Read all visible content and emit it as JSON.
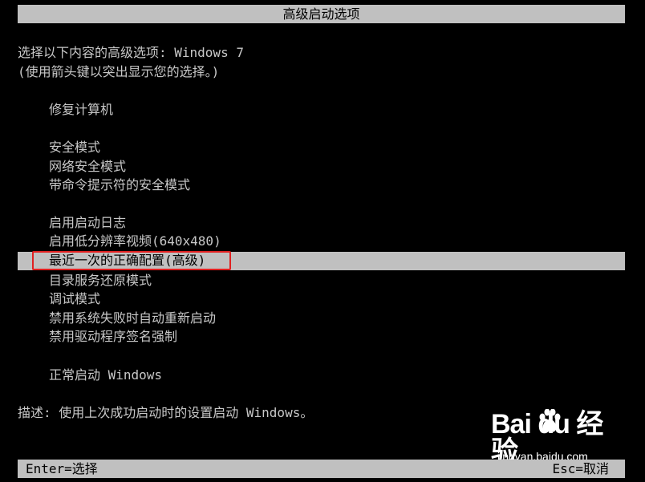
{
  "header": {
    "title": "高级启动选项"
  },
  "prompt": {
    "line1": "选择以下内容的高级选项: Windows 7",
    "line2": "(使用箭头键以突出显示您的选择。)"
  },
  "menu": {
    "repair": "修复计算机",
    "safe_mode": "安全模式",
    "safe_mode_network": "网络安全模式",
    "safe_mode_cmd": "带命令提示符的安全模式",
    "boot_logging": "启用启动日志",
    "low_res_video": "启用低分辨率视频(640x480)",
    "last_known_good": "最近一次的正确配置(高级)",
    "ds_restore": "目录服务还原模式",
    "debugging": "调试模式",
    "disable_auto_restart": "禁用系统失败时自动重新启动",
    "disable_driver_sig": "禁用驱动程序签名强制",
    "start_normally": "正常启动 Windows"
  },
  "description": "描述: 使用上次成功启动时的设置启动 Windows。",
  "footer": {
    "enter": "Enter=选择",
    "esc": "Esc=取消"
  },
  "watermark": {
    "logo": "Bai du 经验",
    "url": "jingyan.baidu.com"
  },
  "colors": {
    "background": "#000000",
    "text": "#c8c8c8",
    "bar": "#c0c0c0",
    "annotation": "#e02020"
  }
}
